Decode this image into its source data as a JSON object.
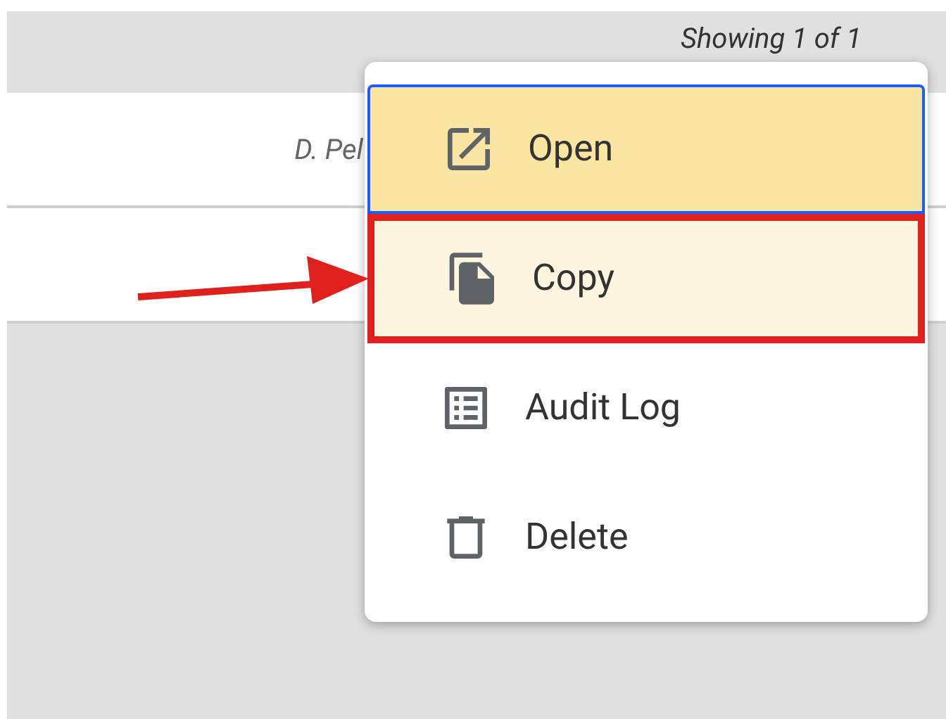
{
  "status": "Showing 1 of 1",
  "rows": [
    {
      "cells": [
        "D. Pel"
      ]
    },
    {
      "cells": []
    }
  ],
  "menu": {
    "items": [
      {
        "label": "Open",
        "focused": true,
        "annotated": false
      },
      {
        "label": "Copy",
        "focused": false,
        "annotated": true
      },
      {
        "label": "Audit Log",
        "focused": false,
        "annotated": false
      },
      {
        "label": "Delete",
        "focused": false,
        "annotated": false
      }
    ]
  }
}
